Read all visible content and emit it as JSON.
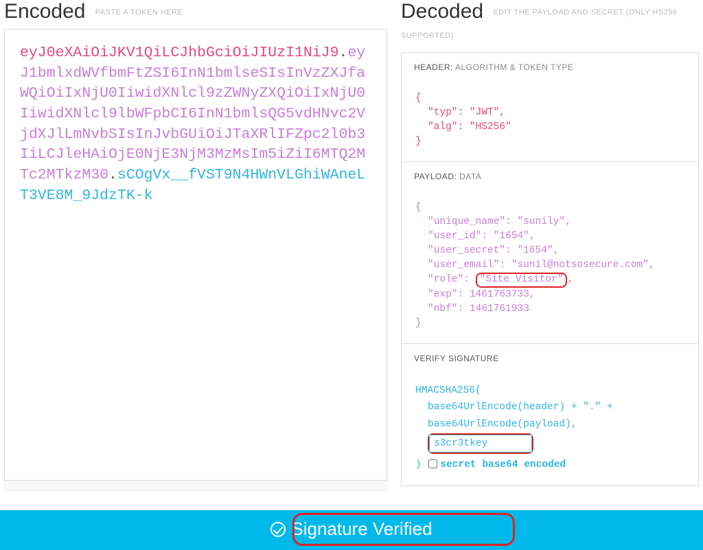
{
  "encoded": {
    "title": "Encoded",
    "hint": "PASTE A TOKEN HERE",
    "token_header": "eyJ0eXAiOiJKV1QiLCJhbGciOiJIUzI1NiJ9",
    "token_payload": "eyJ1bmlxdWVfbmFtZSI6InN1bmlseSIsInVzZXJfaWQiOiIxNjU0IiwidXNlcl9zZWNyZXQiOiIxNjU0IiwidXNlcl9lbWFpbCI6InN1bmlsQG5vdHNvc2VjdXJlLmNvbSIsInJvbGUiOiJTaXRlIFZpc2l0b3IiLCJleHAiOjE0NjE3NjM3MzMsIm5iZiI6MTQ2MTc2MTkzM30",
    "token_sig": "sCOgVx__fVST9N4HWnVLGhiWAneLT3VE8M_9JdzTK-k"
  },
  "decoded": {
    "title": "Decoded",
    "hint": "EDIT THE PAYLOAD AND SECRET (ONLY HS256 SUPPORTED)",
    "header_section": {
      "label_main": "HEADER:",
      "label_sub": "ALGORITHM & TOKEN TYPE"
    },
    "header_json": {
      "open": "{",
      "typ_line": "\"typ\": \"JWT\",",
      "alg_line": "\"alg\": \"HS256\"",
      "close": "}"
    },
    "payload_section": {
      "label_main": "PAYLOAD:",
      "label_sub": "DATA"
    },
    "payload_json": {
      "open": "{",
      "unique_name": "\"unique_name\": \"sunily\",",
      "user_id": "\"user_id\": \"1654\",",
      "user_secret": "\"user_secret\": \"1654\",",
      "user_email": "\"user_email\": \"sunil@notsosecure.com\",",
      "role_key": "\"role\": ",
      "role_val": "\"Site Visitor\"",
      "role_comma": ",",
      "exp": "\"exp\": 1461763733,",
      "nbf": "\"nbf\": 1461761933",
      "close": "}"
    },
    "signature_section": {
      "label_main": "VERIFY SIGNATURE"
    },
    "signature": {
      "func": "HMACSHA256(",
      "line1": "base64UrlEncode(header) + \".\" +",
      "line2": "base64UrlEncode(payload),",
      "secret": "s3cr3tkey",
      "close": ") ",
      "checkbox_label": "secret base64 encoded"
    }
  },
  "banner": {
    "text": "Signature Verified"
  }
}
